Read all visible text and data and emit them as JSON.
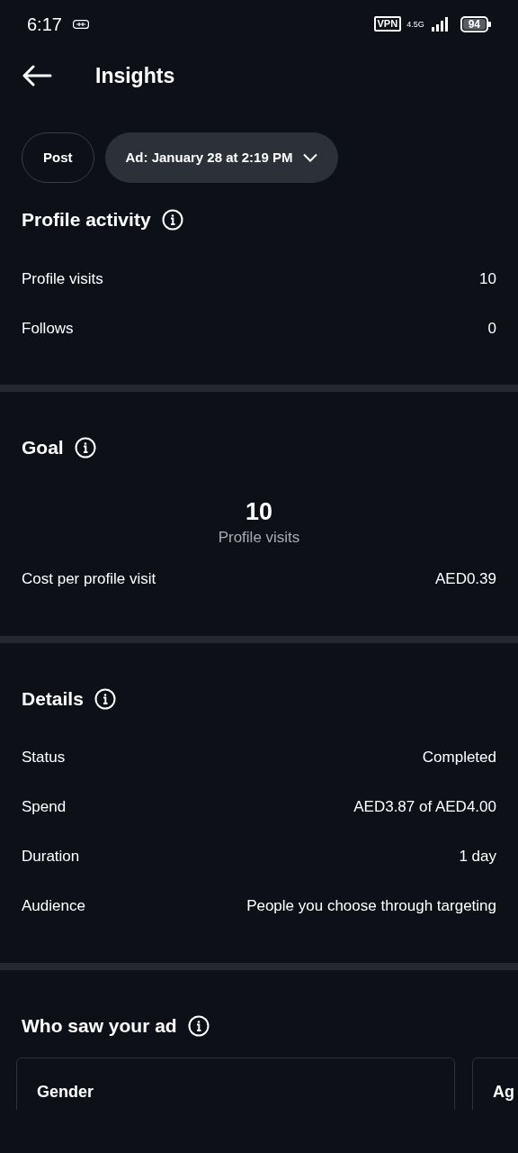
{
  "status_bar": {
    "time": "6:17",
    "network": "4.5G",
    "battery": "94",
    "vpn": "VPN"
  },
  "header": {
    "title": "Insights"
  },
  "chips": [
    {
      "label": "Post",
      "selected": false,
      "dropdown": false
    },
    {
      "label": "Ad: January 28 at 2:19 PM",
      "selected": true,
      "dropdown": true
    }
  ],
  "sections": [
    {
      "kind": "rows",
      "title": "Profile activity",
      "rows": [
        {
          "label": "Profile visits",
          "value": "10"
        },
        {
          "label": "Follows",
          "value": "0"
        }
      ]
    },
    {
      "kind": "goal",
      "title": "Goal",
      "metric_value": "10",
      "metric_label": "Profile visits",
      "rows": [
        {
          "label": "Cost per profile visit",
          "value": "AED0.39"
        }
      ]
    },
    {
      "kind": "rows",
      "title": "Details",
      "rows": [
        {
          "label": "Status",
          "value": "Completed"
        },
        {
          "label": "Spend",
          "value": "AED3.87 of AED4.00"
        },
        {
          "label": "Duration",
          "value": "1 day"
        },
        {
          "label": "Audience",
          "value": "People you choose through targeting"
        }
      ]
    },
    {
      "kind": "cards",
      "title": "Who saw your ad",
      "cards": [
        "Gender",
        "Ag"
      ]
    }
  ]
}
